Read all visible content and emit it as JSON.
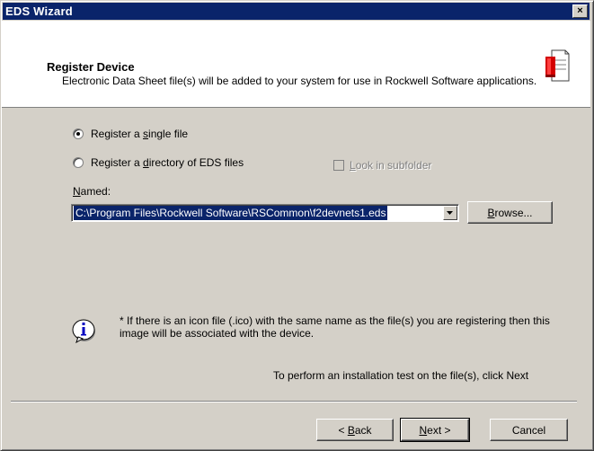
{
  "window": {
    "title": "EDS Wizard",
    "close_glyph": "×"
  },
  "header": {
    "title": "Register Device",
    "description": "Electronic Data Sheet file(s) will be added to your system for use in Rockwell Software applications.",
    "icon": "eds-document-icon"
  },
  "options": {
    "single_file": {
      "label_pre": "Register a ",
      "label_key": "s",
      "label_post": "ingle file",
      "selected": true
    },
    "directory": {
      "label_pre": "Register a ",
      "label_key": "d",
      "label_post": "irectory of EDS files",
      "selected": false
    },
    "subfolder": {
      "label_key": "L",
      "label_post": "ook in subfolder",
      "checked": false,
      "enabled": false
    }
  },
  "named": {
    "label_key": "N",
    "label_post": "amed:",
    "value": "C:\\Program Files\\Rockwell Software\\RSCommon\\f2devnets1.eds",
    "browse_key": "B",
    "browse_post": "rowse..."
  },
  "info": {
    "icon": "info-icon",
    "text": "* If there is an icon file (.ico) with the same name as the file(s) you are registering then this image will be associated with the device."
  },
  "hint": "To perform an installation test on the file(s), click Next",
  "buttons": {
    "back_pre": "< ",
    "back_key": "B",
    "back_post": "ack",
    "next_key": "N",
    "next_post": "ext >",
    "cancel": "Cancel"
  },
  "colors": {
    "titlebar": "#0a246a",
    "face": "#d4d0c8",
    "selection": "#0a246a"
  }
}
